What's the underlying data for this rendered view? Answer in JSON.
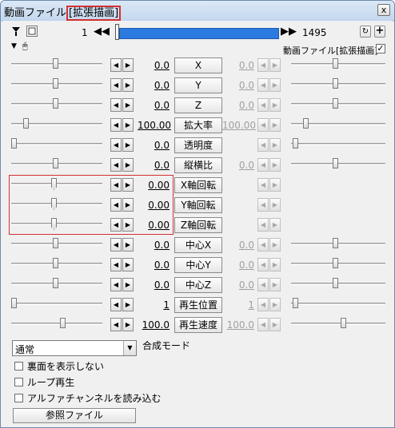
{
  "window": {
    "title_prefix": "動画ファイル",
    "title_highlight": "[拡張描画]",
    "close_label": "x"
  },
  "toolbar": {
    "start_frame": "1",
    "end_frame": "1495",
    "prev_label": "◀◀",
    "next_label": "▶▶",
    "plus_label": "+",
    "seek_fill_fraction": 1.0
  },
  "object_header": {
    "name": "動画ファイル[拡張描画]",
    "checked": true
  },
  "params": [
    {
      "label": "X",
      "left_value": "0.0",
      "right_value": "0.0",
      "right_enabled": false
    },
    {
      "label": "Y",
      "left_value": "0.0",
      "right_value": "0.0",
      "right_enabled": false
    },
    {
      "label": "Z",
      "left_value": "0.0",
      "right_value": "0.0",
      "right_enabled": false
    },
    {
      "label": "拡大率",
      "left_value": "100.00",
      "right_value": "100.00",
      "right_enabled": false
    },
    {
      "label": "透明度",
      "left_value": "0.0",
      "right_value": "",
      "right_enabled": false
    },
    {
      "label": "縦横比",
      "left_value": "0.0",
      "right_value": "0.0",
      "right_enabled": false
    },
    {
      "label": "X軸回転",
      "left_value": "0.00",
      "right_value": "",
      "right_enabled": false
    },
    {
      "label": "Y軸回転",
      "left_value": "0.00",
      "right_value": "",
      "right_enabled": false
    },
    {
      "label": "Z軸回転",
      "left_value": "0.00",
      "right_value": "",
      "right_enabled": false
    },
    {
      "label": "中心X",
      "left_value": "0.0",
      "right_value": "0.0",
      "right_enabled": false
    },
    {
      "label": "中心Y",
      "left_value": "0.0",
      "right_value": "0.0",
      "right_enabled": false
    },
    {
      "label": "中心Z",
      "left_value": "0.0",
      "right_value": "0.0",
      "right_enabled": false
    },
    {
      "label": "再生位置",
      "left_value": "1",
      "right_value": "1",
      "right_enabled": false
    },
    {
      "label": "再生速度",
      "left_value": "100.0",
      "right_value": "100.0",
      "right_enabled": false
    }
  ],
  "blend": {
    "selected": "通常",
    "label": "合成モード"
  },
  "checkboxes": [
    {
      "label": "裏面を表示しない",
      "checked": false
    },
    {
      "label": "ループ再生",
      "checked": false
    },
    {
      "label": "アルファチャンネルを読み込む",
      "checked": false
    }
  ],
  "ref_button": "参照ファイル",
  "colors": {
    "highlight": "#d43030",
    "seek_bar": "#2b7ae0"
  }
}
